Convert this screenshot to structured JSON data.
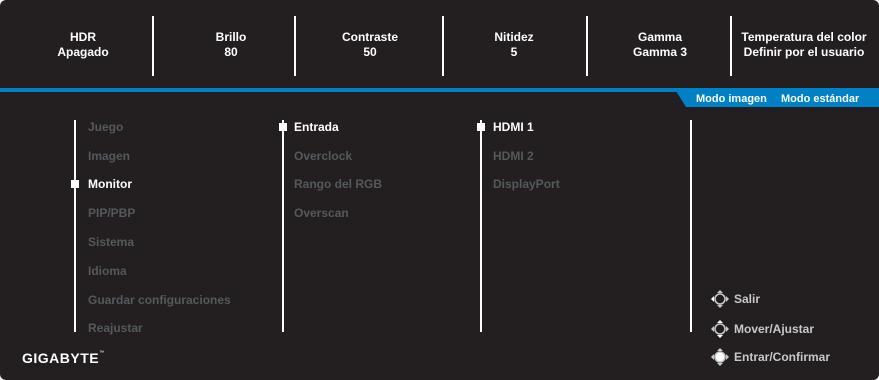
{
  "status_bar": [
    {
      "label": "HDR",
      "value": "Apagado"
    },
    {
      "label": "Brillo",
      "value": "80"
    },
    {
      "label": "Contraste",
      "value": "50"
    },
    {
      "label": "Nitidez",
      "value": "5"
    },
    {
      "label": "Gamma",
      "value": "Gamma 3"
    },
    {
      "label": "Temperatura del color",
      "value": "Definir por el usuario"
    }
  ],
  "picture_mode": {
    "label": "Modo imagen",
    "value": "Modo estándar"
  },
  "main_menu": [
    "Juego",
    "Imagen",
    "Monitor",
    "PIP/PBP",
    "Sistema",
    "Idioma",
    "Guardar configuraciones",
    "Reajustar"
  ],
  "main_menu_selected": "Monitor",
  "submenu": [
    "Entrada",
    "Overclock",
    "Rango del RGB",
    "Overscan"
  ],
  "submenu_selected": "Entrada",
  "options": [
    "HDMI 1",
    "HDMI 2",
    "DisplayPort"
  ],
  "options_selected": "HDMI 1",
  "brand": "GIGABYTE",
  "help": [
    {
      "icon": "joystick-left-icon",
      "label": "Salir"
    },
    {
      "icon": "joystick-updown-icon",
      "label": "Mover/Ajustar"
    },
    {
      "icon": "joystick-press-icon",
      "label": "Entrar/Confirmar"
    }
  ],
  "colors": {
    "background": "#231f20",
    "accent": "#0081c6",
    "active_text": "#ffffff",
    "inactive_text": "#55585c"
  }
}
